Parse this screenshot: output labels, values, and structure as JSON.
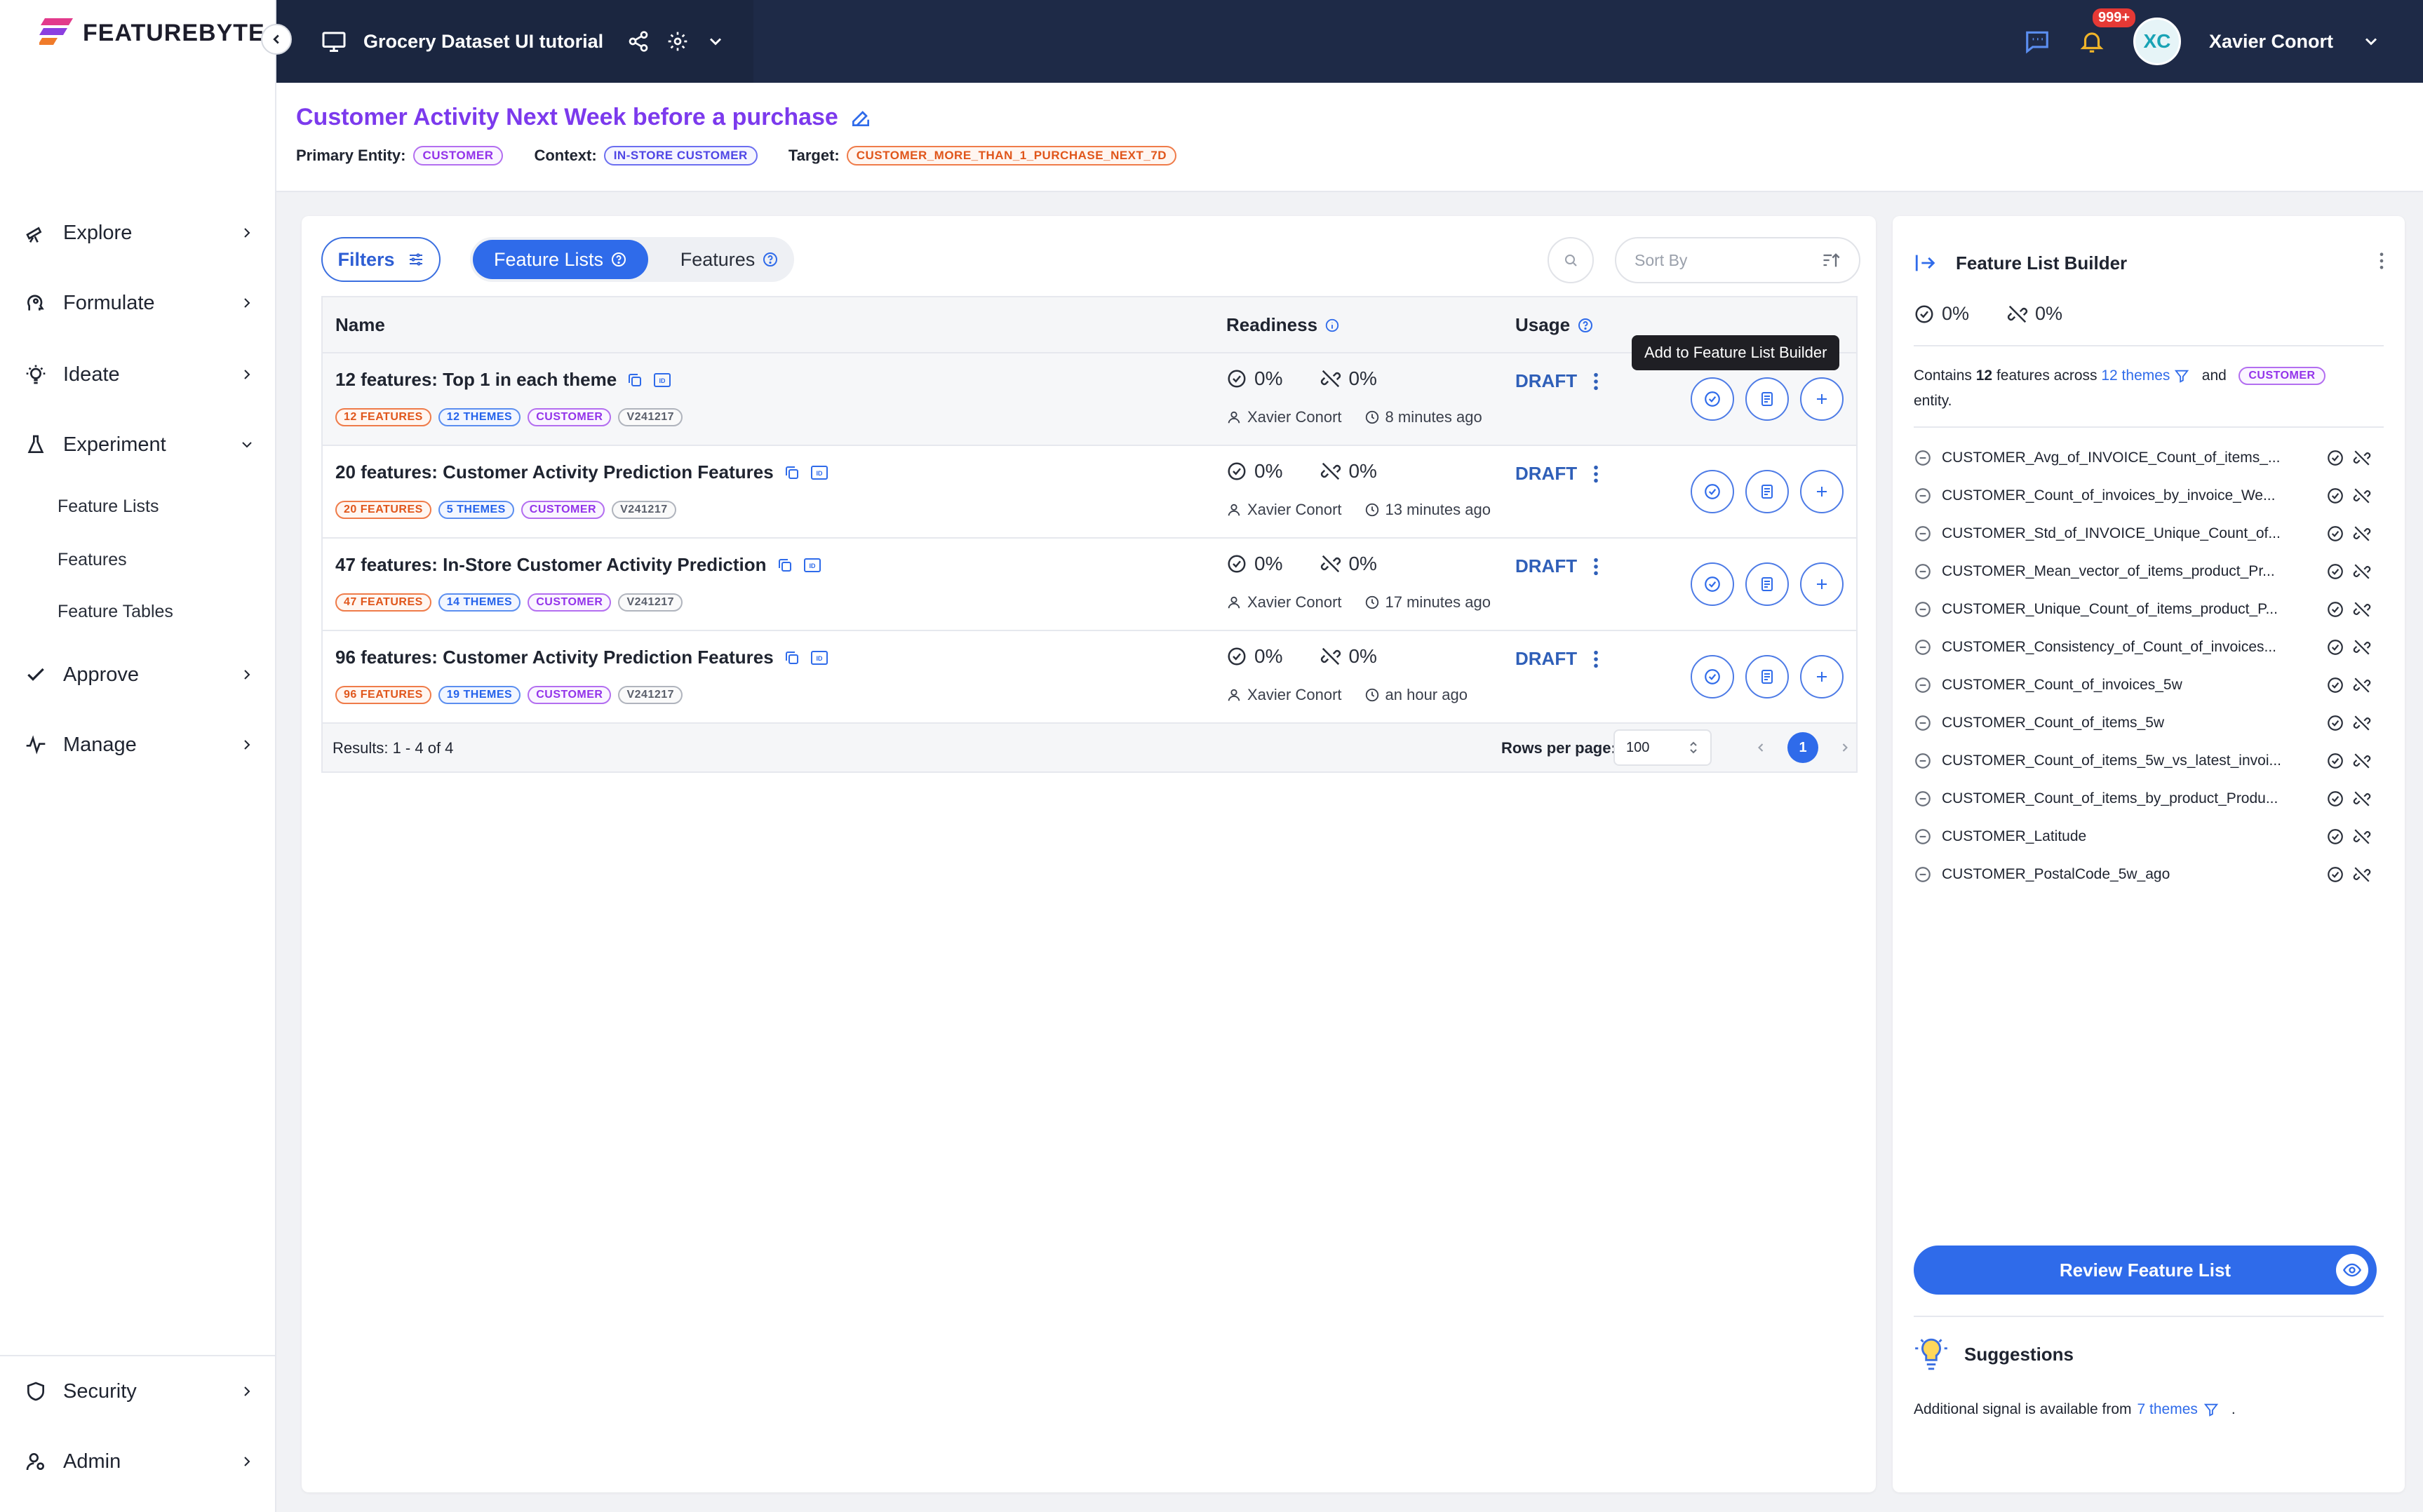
{
  "brand": {
    "name": "FEATUREBYTE"
  },
  "topbar": {
    "project_title": "Grocery Dataset UI tutorial",
    "notifications": "999+",
    "avatar_initials": "XC",
    "user_name": "Xavier Conort"
  },
  "sidebar": {
    "items": [
      {
        "label": "Explore",
        "icon": "telescope-icon"
      },
      {
        "label": "Formulate",
        "icon": "head-icon"
      },
      {
        "label": "Ideate",
        "icon": "lightbulb-icon"
      },
      {
        "label": "Experiment",
        "icon": "flask-icon"
      },
      {
        "label": "Approve",
        "icon": "check-icon"
      },
      {
        "label": "Manage",
        "icon": "activity-icon"
      }
    ],
    "subitems": [
      "Feature Lists",
      "Features",
      "Feature Tables"
    ],
    "bottom": [
      {
        "label": "Security",
        "icon": "shield-icon"
      },
      {
        "label": "Admin",
        "icon": "admin-icon"
      }
    ]
  },
  "header": {
    "title": "Customer Activity Next Week before a purchase",
    "primary_entity_label": "Primary Entity:",
    "primary_entity": "CUSTOMER",
    "context_label": "Context:",
    "context": "IN-STORE CUSTOMER",
    "target_label": "Target:",
    "target": "CUSTOMER_MORE_THAN_1_PURCHASE_NEXT_7D"
  },
  "toolbar": {
    "filters_label": "Filters",
    "tab_feature_lists": "Feature Lists",
    "tab_features": "Features",
    "sort_placeholder": "Sort By"
  },
  "table": {
    "columns": {
      "name": "Name",
      "readiness": "Readiness",
      "usage": "Usage"
    },
    "rows": [
      {
        "name": "12 features: Top 1 in each theme",
        "features_tag": "12 FEATURES",
        "themes_tag": "12 THEMES",
        "entity_tag": "CUSTOMER",
        "version_tag": "V241217",
        "readiness": "0%",
        "online": "0%",
        "author": "Xavier Conort",
        "time": "8 minutes ago",
        "status": "DRAFT"
      },
      {
        "name": "20 features: Customer Activity Prediction Features",
        "features_tag": "20 FEATURES",
        "themes_tag": "5 THEMES",
        "entity_tag": "CUSTOMER",
        "version_tag": "V241217",
        "readiness": "0%",
        "online": "0%",
        "author": "Xavier Conort",
        "time": "13 minutes ago",
        "status": "DRAFT"
      },
      {
        "name": "47 features: In-Store Customer Activity Prediction",
        "features_tag": "47 FEATURES",
        "themes_tag": "14 THEMES",
        "entity_tag": "CUSTOMER",
        "version_tag": "V241217",
        "readiness": "0%",
        "online": "0%",
        "author": "Xavier Conort",
        "time": "17 minutes ago",
        "status": "DRAFT"
      },
      {
        "name": "96 features: Customer Activity Prediction Features",
        "features_tag": "96 FEATURES",
        "themes_tag": "19 THEMES",
        "entity_tag": "CUSTOMER",
        "version_tag": "V241217",
        "readiness": "0%",
        "online": "0%",
        "author": "Xavier Conort",
        "time": "an hour ago",
        "status": "DRAFT"
      }
    ],
    "results": "Results: 1 - 4 of 4",
    "rows_per_page_label": "Rows per page:",
    "rows_per_page": "100",
    "page": "1"
  },
  "tooltip": "Add to Feature List Builder",
  "builder": {
    "title": "Feature List Builder",
    "readiness": "0%",
    "online": "0%",
    "contains_prefix": "Contains",
    "feature_count": "12",
    "features_across": "features across",
    "themes_link": "12 themes",
    "and": "and",
    "entity": "CUSTOMER",
    "entity_suffix": "entity.",
    "features": [
      "CUSTOMER_Avg_of_INVOICE_Count_of_items_...",
      "CUSTOMER_Count_of_invoices_by_invoice_We...",
      "CUSTOMER_Std_of_INVOICE_Unique_Count_of...",
      "CUSTOMER_Mean_vector_of_items_product_Pr...",
      "CUSTOMER_Unique_Count_of_items_product_P...",
      "CUSTOMER_Consistency_of_Count_of_invoices...",
      "CUSTOMER_Count_of_invoices_5w",
      "CUSTOMER_Count_of_items_5w",
      "CUSTOMER_Count_of_items_5w_vs_latest_invoi...",
      "CUSTOMER_Count_of_items_by_product_Produ...",
      "CUSTOMER_Latitude",
      "CUSTOMER_PostalCode_5w_ago"
    ],
    "review_label": "Review Feature List",
    "suggestions_title": "Suggestions",
    "suggestion_prefix": "Additional signal is available from",
    "suggestion_link": "7 themes",
    "suggestion_suffix": "."
  }
}
